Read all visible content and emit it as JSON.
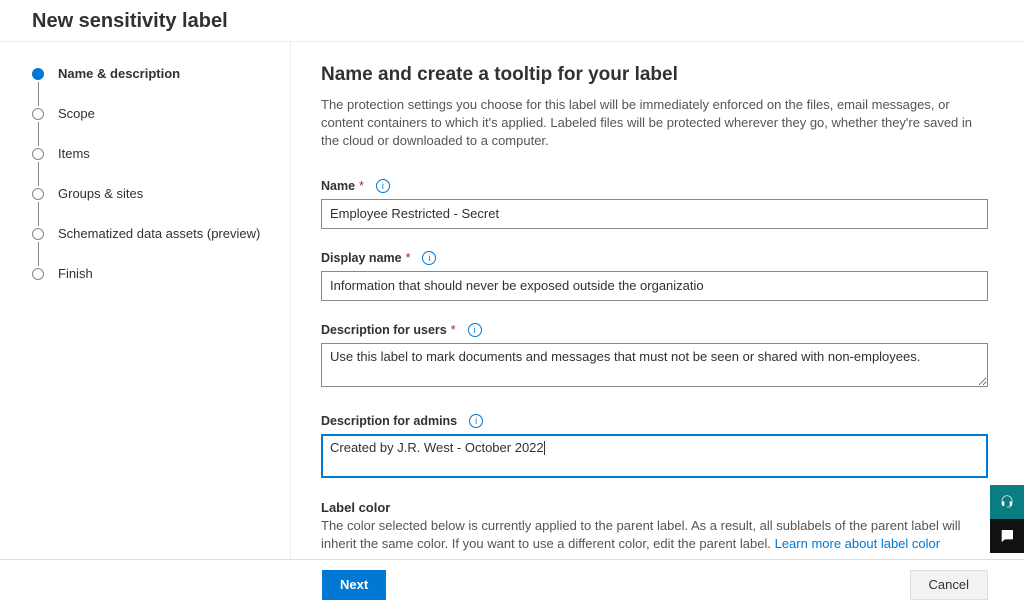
{
  "header": {
    "title": "New sensitivity label"
  },
  "steps": [
    {
      "label": "Name & description",
      "active": true
    },
    {
      "label": "Scope",
      "active": false
    },
    {
      "label": "Items",
      "active": false
    },
    {
      "label": "Groups & sites",
      "active": false
    },
    {
      "label": "Schematized data assets (preview)",
      "active": false
    },
    {
      "label": "Finish",
      "active": false
    }
  ],
  "main": {
    "heading": "Name and create a tooltip for your label",
    "intro": "The protection settings you choose for this label will be immediately enforced on the files, email messages, or content containers to which it's applied. Labeled files will be protected wherever they go, whether they're saved in the cloud or downloaded to a computer.",
    "fields": {
      "name": {
        "label": "Name",
        "value": "Employee Restricted - Secret"
      },
      "display_name": {
        "label": "Display name",
        "value": "Information that should never be exposed outside the organizatio"
      },
      "desc_users": {
        "label": "Description for users",
        "value": "Use this label to mark documents and messages that must not be seen or shared with non-employees."
      },
      "desc_admins": {
        "label": "Description for admins",
        "value": "Created by J.R. West - October 2022"
      }
    },
    "label_color": {
      "title": "Label color",
      "desc": "The color selected below is currently applied to the parent label. As a result, all sublabels of the parent label will inherit the same color. If you want to use a different color, edit the parent label. ",
      "link": "Learn more about label color",
      "swatches": [
        "#3b3a39",
        "#8c969c",
        "#7a7a7a",
        "#c239b3",
        "#6264d7",
        "#2f8cd8",
        "#107c10",
        "#f2c811",
        "#e8710a",
        "#a4262c"
      ]
    }
  },
  "footer": {
    "next": "Next",
    "cancel": "Cancel"
  }
}
